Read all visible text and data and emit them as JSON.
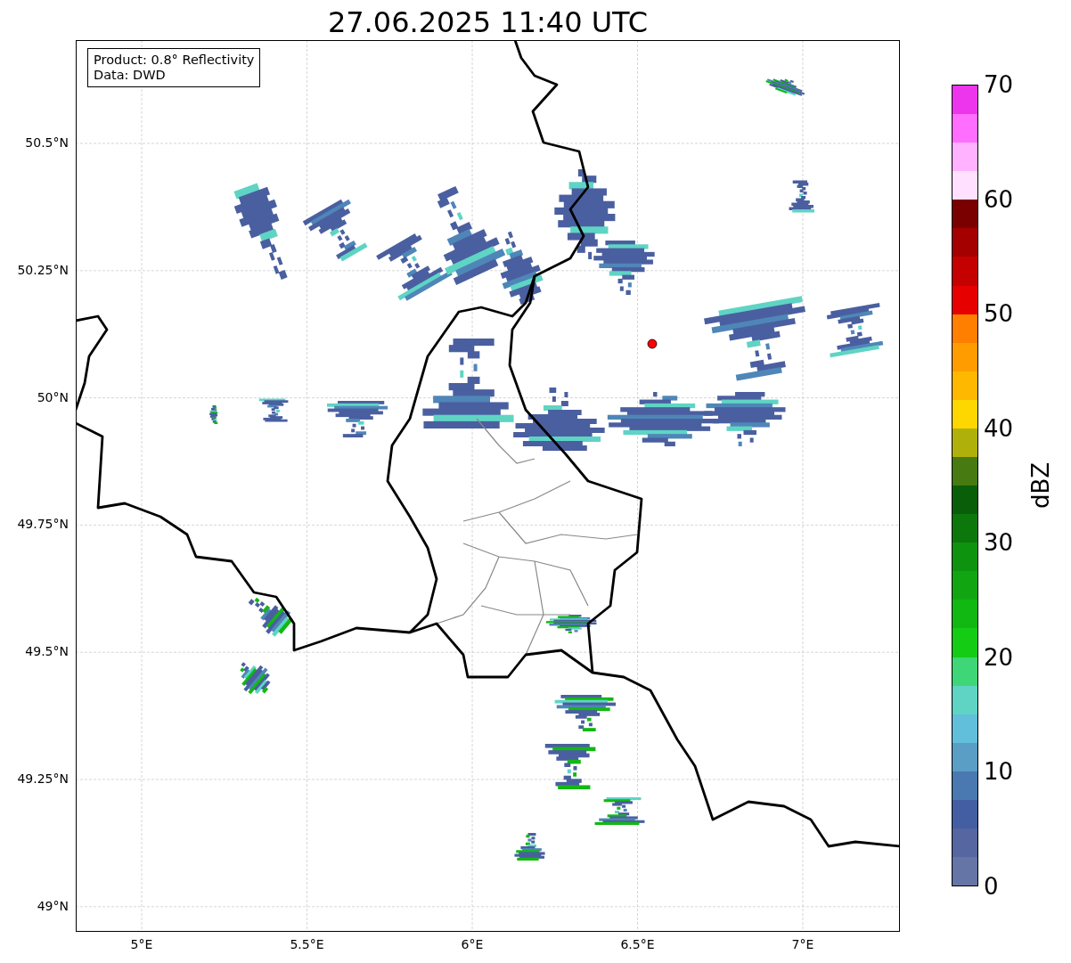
{
  "title": "27.06.2025 11:40 UTC",
  "info_box": [
    "Product: 0.8° Reflectivity",
    "Data: DWD"
  ],
  "map": {
    "lat_ticks": [
      "50.5°N",
      "50.25°N",
      "50°N",
      "49.75°N",
      "49.5°N",
      "49.25°N",
      "49°N"
    ],
    "lon_ticks": [
      "5°E",
      "5.5°E",
      "6°E",
      "6.5°E",
      "7°E"
    ]
  },
  "colorbar": {
    "label": "dBZ",
    "ticks": [
      "70",
      "60",
      "50",
      "40",
      "30",
      "20",
      "10",
      "0"
    ],
    "bins": [
      {
        "color": "#ee35ee"
      },
      {
        "color": "#ff6eff"
      },
      {
        "color": "#ffb2ff"
      },
      {
        "color": "#ffe0ff"
      },
      {
        "color": "#7a0000"
      },
      {
        "color": "#a40000"
      },
      {
        "color": "#c40000"
      },
      {
        "color": "#e60000"
      },
      {
        "color": "#ff7f00"
      },
      {
        "color": "#ff9d00"
      },
      {
        "color": "#ffb800"
      },
      {
        "color": "#ffd700"
      },
      {
        "color": "#b0b00a"
      },
      {
        "color": "#477a10"
      },
      {
        "color": "#095e09"
      },
      {
        "color": "#0c780c"
      },
      {
        "color": "#0e930e"
      },
      {
        "color": "#11a611"
      },
      {
        "color": "#12b812"
      },
      {
        "color": "#14cc14"
      },
      {
        "color": "#3ed676"
      },
      {
        "color": "#5fd4c4"
      },
      {
        "color": "#62bfdb"
      },
      {
        "color": "#5a9ec6"
      },
      {
        "color": "#4a78b0"
      },
      {
        "color": "#435ea3"
      },
      {
        "color": "#5566a0"
      },
      {
        "color": "#6475a6"
      }
    ]
  }
}
